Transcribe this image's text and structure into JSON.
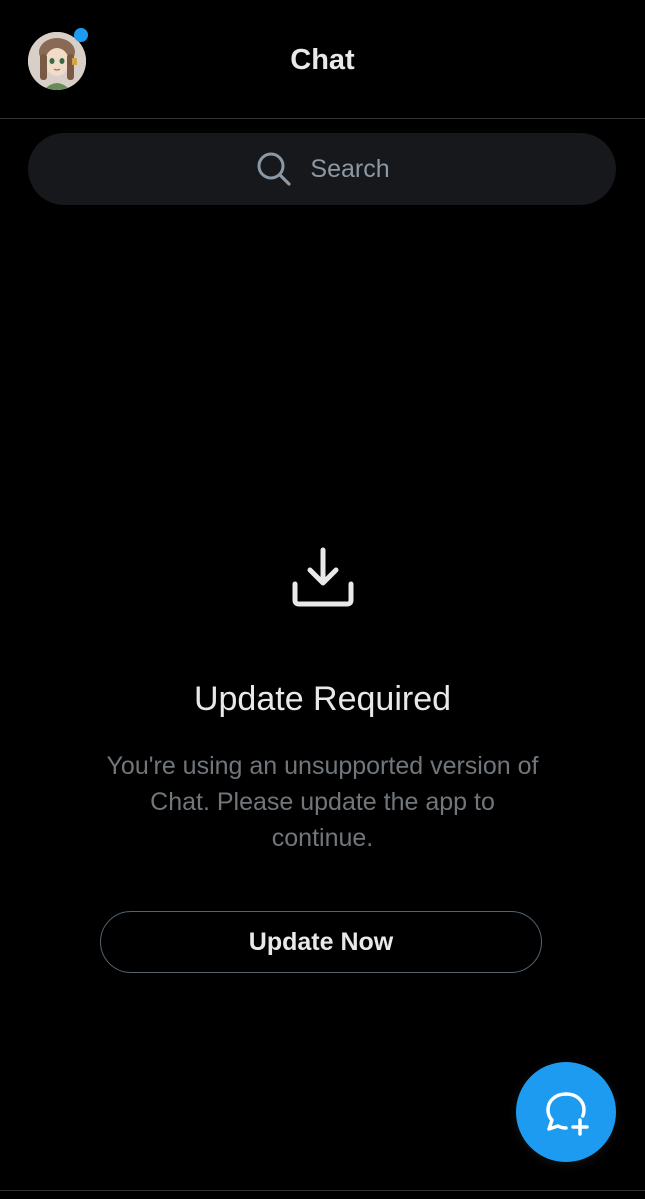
{
  "header": {
    "title": "Chat",
    "avatar_icon": "user-avatar",
    "has_notification": true
  },
  "search": {
    "placeholder": "Search",
    "icon": "search-icon"
  },
  "empty_state": {
    "icon": "download-icon",
    "title": "Update Required",
    "description": "You're using an unsupported version of Chat. Please update the app to continue.",
    "button_label": "Update Now"
  },
  "fab": {
    "icon": "new-chat-icon"
  },
  "colors": {
    "accent": "#1d9bf0",
    "background": "#000000",
    "text_primary": "#e7e9ea",
    "text_secondary": "#71767b",
    "divider": "#2f3336"
  }
}
